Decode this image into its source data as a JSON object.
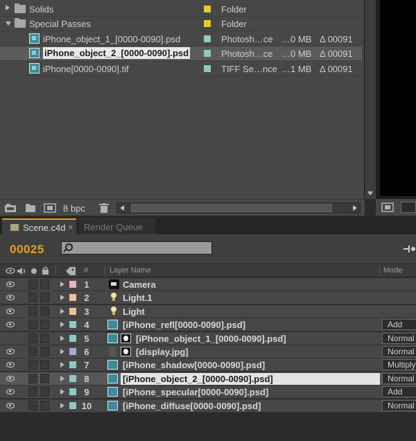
{
  "project": {
    "items": [
      {
        "name": "Solids",
        "kind": "folder",
        "expanded": false,
        "indent": 0,
        "label_color": "#e6c830",
        "type": "Folder",
        "size": "",
        "duration": "",
        "selected": false,
        "boxed": false
      },
      {
        "name": "Special Passes",
        "kind": "folder",
        "expanded": true,
        "indent": 0,
        "label_color": "#e6c830",
        "type": "Folder",
        "size": "",
        "duration": "",
        "selected": false,
        "boxed": false
      },
      {
        "name": "iPhone_object_1_[0000-0090].psd",
        "kind": "psd",
        "indent": 1,
        "label_color": "#8fc8c4",
        "type": "Photosh…ce",
        "size": "…0 MB",
        "duration": "Δ 00091",
        "selected": false,
        "boxed": false
      },
      {
        "name": "iPhone_object_2_[0000-0090].psd",
        "kind": "psd",
        "indent": 1,
        "label_color": "#8fc8c4",
        "type": "Photosh…ce",
        "size": "…0 MB",
        "duration": "Δ 00091",
        "selected": true,
        "boxed": true
      },
      {
        "name": "iPhone[0000-0090].tif",
        "kind": "tif",
        "indent": 1,
        "label_color": "#8fc8c4",
        "type": "TIFF Se…nce",
        "size": "…1 MB",
        "duration": "Δ 00091",
        "selected": false,
        "boxed": false
      }
    ],
    "footer": {
      "bit_depth": "8 bpc"
    }
  },
  "timeline": {
    "tabs": [
      {
        "label": "Scene.c4d",
        "active": true
      },
      {
        "label": "Render Queue",
        "active": false
      }
    ],
    "close_glyph": "×",
    "timecode": "00025",
    "search": {
      "value": "",
      "placeholder": ""
    },
    "columns": {
      "num": "#",
      "layer_name": "Layer Name",
      "mode": "Mode"
    },
    "layers": [
      {
        "num": "1",
        "name": "Camera",
        "icon": "camera",
        "label_color": "#e6b4c4",
        "mode": "",
        "visible": true,
        "selected": false,
        "boxed": false
      },
      {
        "num": "2",
        "name": "Light.1",
        "icon": "light",
        "label_color": "#f2c098",
        "mode": "",
        "visible": true,
        "selected": false,
        "boxed": false
      },
      {
        "num": "3",
        "name": "Light",
        "icon": "light",
        "label_color": "#f2c098",
        "mode": "",
        "visible": true,
        "selected": false,
        "boxed": false
      },
      {
        "num": "4",
        "name": "[iPhone_refl[0000-0090].psd]",
        "icon": "psd",
        "label_color": "#8fc8c4",
        "mode": "Add",
        "visible": true,
        "selected": false,
        "boxed": false
      },
      {
        "num": "5",
        "name": "[iPhone_object_1_[0000-0090].psd]",
        "icon": "psd-mask",
        "label_color": "#8fc8c4",
        "mode": "Normal",
        "visible": false,
        "selected": false,
        "boxed": false
      },
      {
        "num": "6",
        "name": "[display.jpg]",
        "icon": "film-mask",
        "label_color": "#a8a8d8",
        "mode": "Normal",
        "visible": true,
        "selected": false,
        "boxed": false
      },
      {
        "num": "7",
        "name": "[iPhone_shadow[0000-0090].psd]",
        "icon": "psd",
        "label_color": "#8fc8c4",
        "mode": "Multiply",
        "visible": true,
        "selected": false,
        "boxed": false
      },
      {
        "num": "8",
        "name": "[iPhone_object_2_[0000-0090].psd]",
        "icon": "psd",
        "label_color": "#8fc8c4",
        "mode": "Normal",
        "visible": true,
        "selected": true,
        "boxed": true
      },
      {
        "num": "9",
        "name": "[iPhone_specular[0000-0090].psd]",
        "icon": "psd",
        "label_color": "#8fc8c4",
        "mode": "Add",
        "visible": true,
        "selected": false,
        "boxed": false
      },
      {
        "num": "10",
        "name": "[iPhone_diffuse[0000-0090].psd]",
        "icon": "psd",
        "label_color": "#8fc8c4",
        "mode": "Normal",
        "visible": true,
        "selected": false,
        "boxed": false
      }
    ]
  }
}
